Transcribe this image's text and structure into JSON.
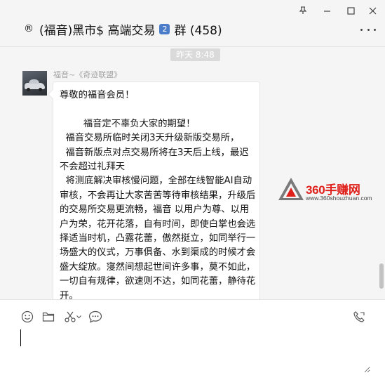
{
  "window": {
    "pin_icon": "pin-icon",
    "minimize_icon": "minimize-icon",
    "maximize_icon": "maximize-icon",
    "close_icon": "close-icon"
  },
  "header": {
    "reg_symbol": "®",
    "chat_title": "(福音)黑市$ 高端交易",
    "title_badge": "2",
    "group_label": "群 (458)",
    "more_icon": "more-icon"
  },
  "chat": {
    "timestamp": "昨天 8:48",
    "messages": [
      {
        "sender": "福音~《奇迹联盟》",
        "text": "尊敬的福音会员！\n\n        福音定不辜负大家的期望！\n  福音交易所临时关闭3天升级新版交易所，\n  福音新版点对点交易所将在3天后上线，最迟不会超过礼拜天\n  将测底解决审核慢问题，全部在线智能AI自动审核，不会再让大家苦苦等待审核结果，升级后的交易所交易更流畅，福音 以用户为尊、以用户为荣，花开花落，自有时间，即使白掌也会选择适当时机，凸露花蕾，傲然挺立，如同举行一场盛大的仪式，万事俱备、水到渠成的时候才会盛大绽放。寖然间想起世间许多事，莫不如此，一切自有规律，欲速则不达，如同花蕾，静待花开。"
      }
    ]
  },
  "watermark": {
    "name": "360手赚网",
    "url": "www.360shouzhuan.com"
  },
  "input": {
    "value": "",
    "toolbar": [
      "emoji-icon",
      "folder-icon",
      "scissors-icon",
      "chat-history-icon",
      "voice-call-icon"
    ]
  },
  "colors": {
    "background": "#f5f5f5",
    "bubble": "#ffffff",
    "watermark_red": "#e0201b",
    "timestamp_bg": "#dadada"
  }
}
